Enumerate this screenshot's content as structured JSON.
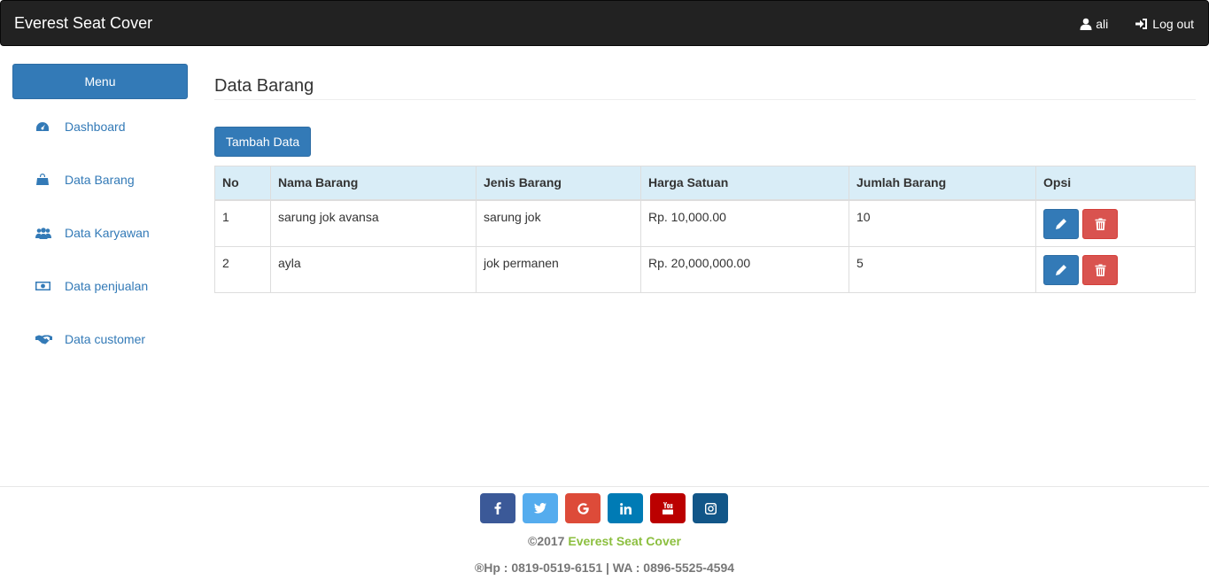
{
  "navbar": {
    "brand": "Everest Seat Cover",
    "user_label": "ali",
    "logout_label": "Log out"
  },
  "sidebar": {
    "menu_label": "Menu",
    "items": [
      {
        "label": "Dashboard",
        "icon": "dashboard-icon"
      },
      {
        "label": "Data Barang",
        "icon": "shopping-bag-icon"
      },
      {
        "label": "Data Karyawan",
        "icon": "users-icon"
      },
      {
        "label": "Data penjualan",
        "icon": "money-icon"
      },
      {
        "label": "Data customer",
        "icon": "handshake-icon"
      }
    ]
  },
  "main": {
    "title": "Data Barang",
    "add_button": "Tambah Data",
    "table": {
      "headers": [
        "No",
        "Nama Barang",
        "Jenis Barang",
        "Harga Satuan",
        "Jumlah Barang",
        "Opsi"
      ],
      "rows": [
        [
          "1",
          "sarung jok avansa",
          "sarung jok",
          "Rp. 10,000.00",
          "10"
        ],
        [
          "2",
          "ayla",
          "jok permanen",
          "Rp. 20,000,000.00",
          "5"
        ]
      ]
    }
  },
  "footer": {
    "socials": [
      {
        "name": "facebook",
        "color": "#3b5998"
      },
      {
        "name": "twitter",
        "color": "#55acee"
      },
      {
        "name": "google",
        "color": "#dd4b39"
      },
      {
        "name": "linkedin",
        "color": "#007bb5"
      },
      {
        "name": "youtube",
        "color": "#bb0000"
      },
      {
        "name": "instagram",
        "color": "#125688"
      }
    ],
    "copyright_prefix": "©2017",
    "copyright_brand": "Everest Seat Cover",
    "contact": "®Hp : 0819-0519-6151 | WA : 0896-5525-4594"
  },
  "colors": {
    "primary": "#337ab7",
    "danger": "#d9534f",
    "navbar": "#222222",
    "table_header": "#d9edf7",
    "brand_green": "#8cbf3f"
  }
}
